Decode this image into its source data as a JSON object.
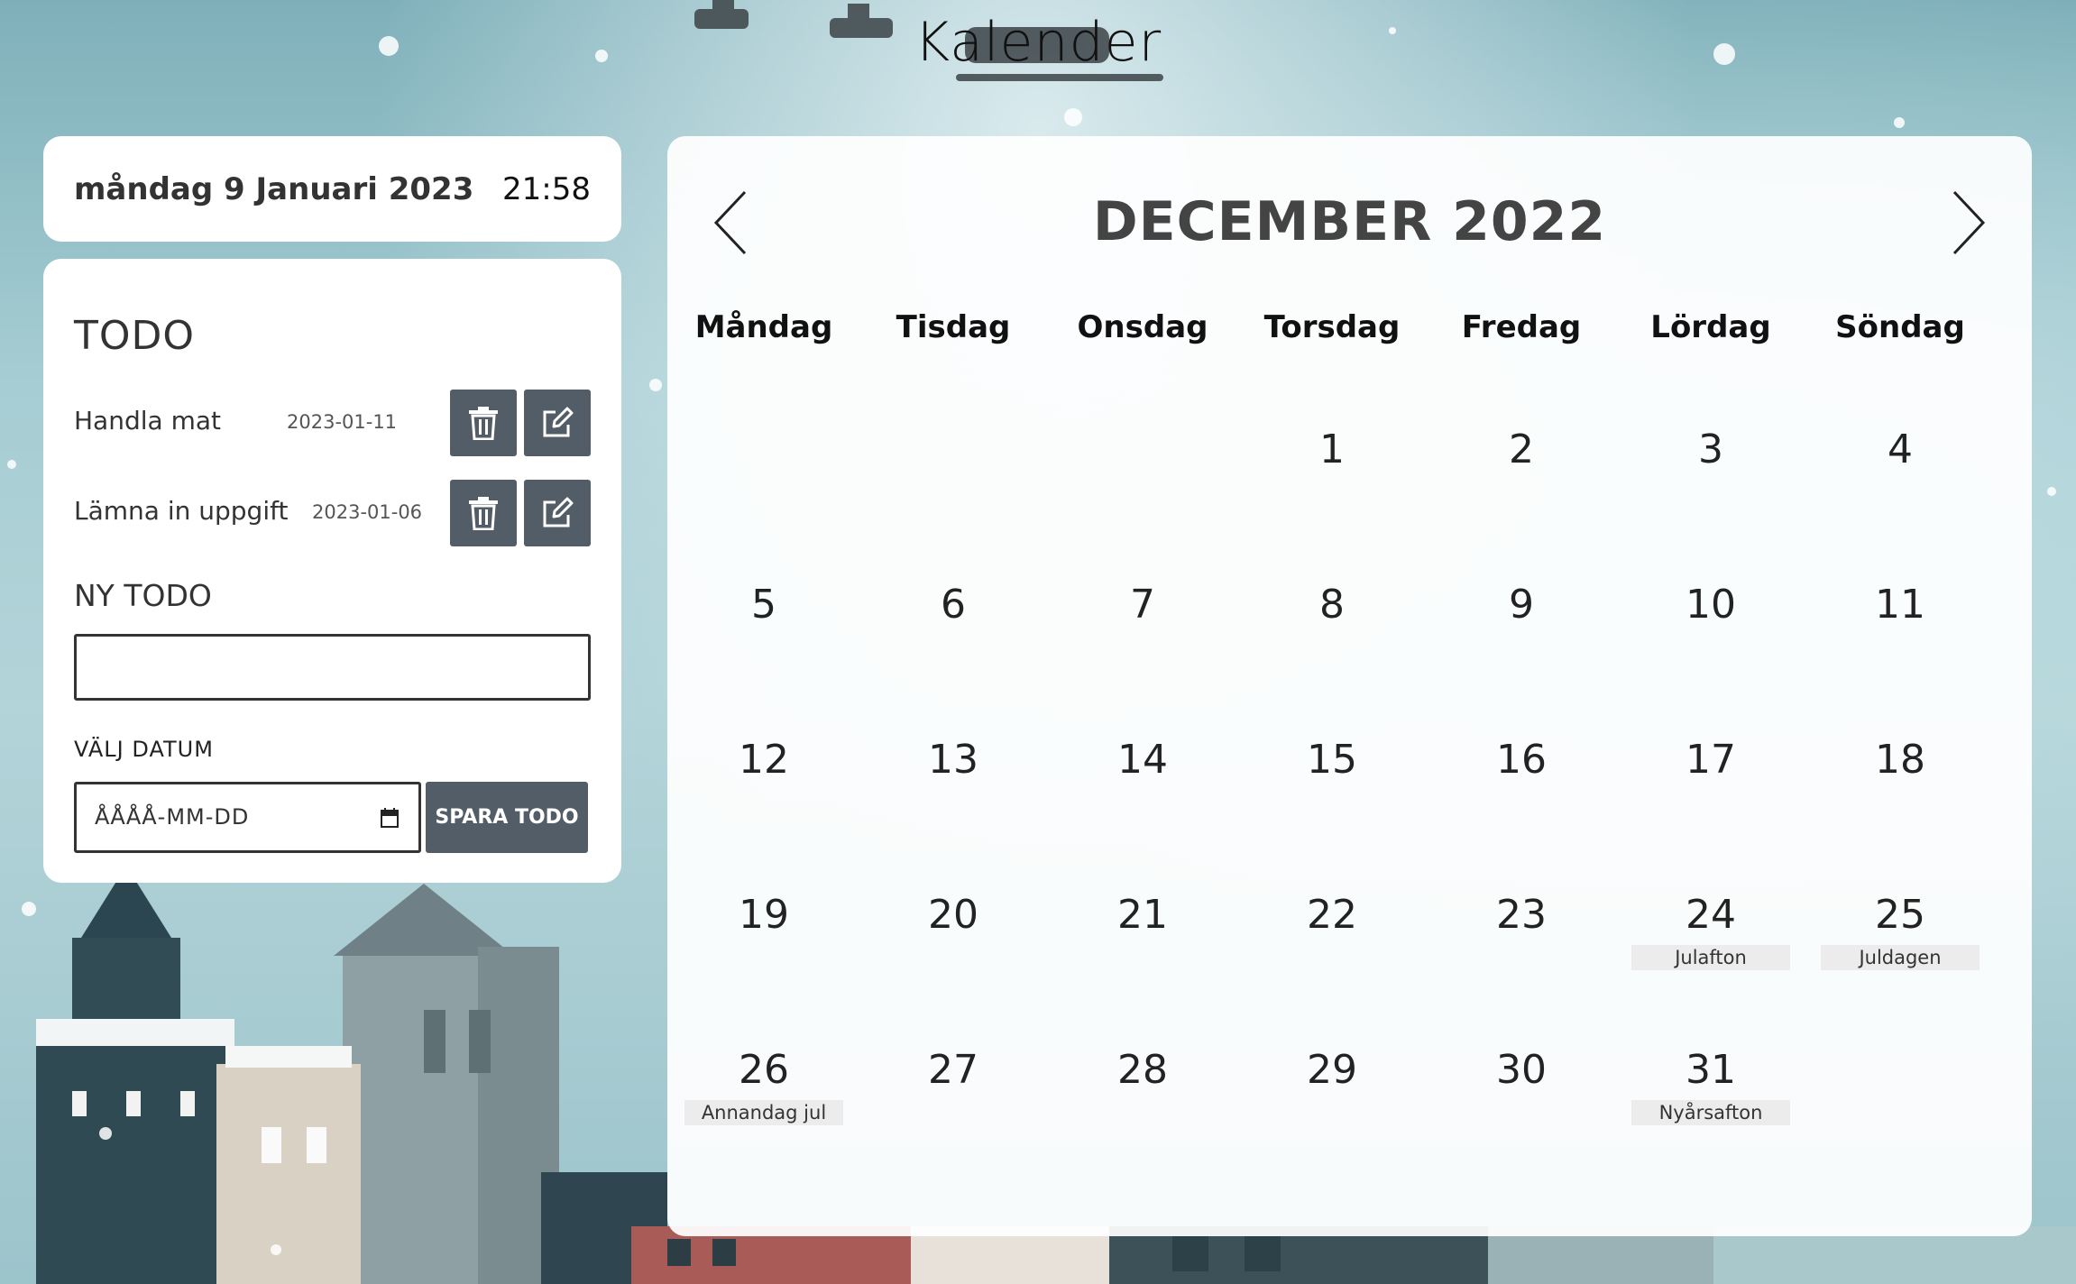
{
  "app_title": "Kalender",
  "current": {
    "date": "måndag 9 Januari 2023",
    "time": "21:58"
  },
  "todo": {
    "title": "TODO",
    "items": [
      {
        "text": "Handla mat",
        "date": "2023-01-11"
      },
      {
        "text": "Lämna in uppgift",
        "date": "2023-01-06"
      }
    ],
    "new_title": "NY TODO",
    "input_value": "",
    "date_label": "VÄLJ DATUM",
    "date_placeholder": "ÅÅÅÅ-MM-DD",
    "save_label": "SPARA TODO"
  },
  "calendar": {
    "month_title": "DECEMBER 2022",
    "weekdays": [
      "Måndag",
      "Tisdag",
      "Onsdag",
      "Torsdag",
      "Fredag",
      "Lördag",
      "Söndag"
    ],
    "first_weekday_index": 3,
    "days": [
      {
        "n": "1"
      },
      {
        "n": "2"
      },
      {
        "n": "3"
      },
      {
        "n": "4"
      },
      {
        "n": "5"
      },
      {
        "n": "6"
      },
      {
        "n": "7"
      },
      {
        "n": "8"
      },
      {
        "n": "9"
      },
      {
        "n": "10"
      },
      {
        "n": "11"
      },
      {
        "n": "12"
      },
      {
        "n": "13"
      },
      {
        "n": "14"
      },
      {
        "n": "15"
      },
      {
        "n": "16"
      },
      {
        "n": "17"
      },
      {
        "n": "18"
      },
      {
        "n": "19"
      },
      {
        "n": "20"
      },
      {
        "n": "21"
      },
      {
        "n": "22"
      },
      {
        "n": "23"
      },
      {
        "n": "24",
        "holiday": "Julafton"
      },
      {
        "n": "25",
        "holiday": "Juldagen"
      },
      {
        "n": "26",
        "holiday": "Annandag jul"
      },
      {
        "n": "27"
      },
      {
        "n": "28"
      },
      {
        "n": "29"
      },
      {
        "n": "30"
      },
      {
        "n": "31",
        "holiday": "Nyårsafton"
      }
    ]
  },
  "icons": {
    "delete": "trash-icon",
    "edit": "edit-icon",
    "prev": "chevron-left-icon",
    "next": "chevron-right-icon",
    "calendar": "calendar-icon"
  },
  "colors": {
    "button": "#535d67",
    "card": "#ffffff",
    "holiday_bg": "#ececec"
  }
}
